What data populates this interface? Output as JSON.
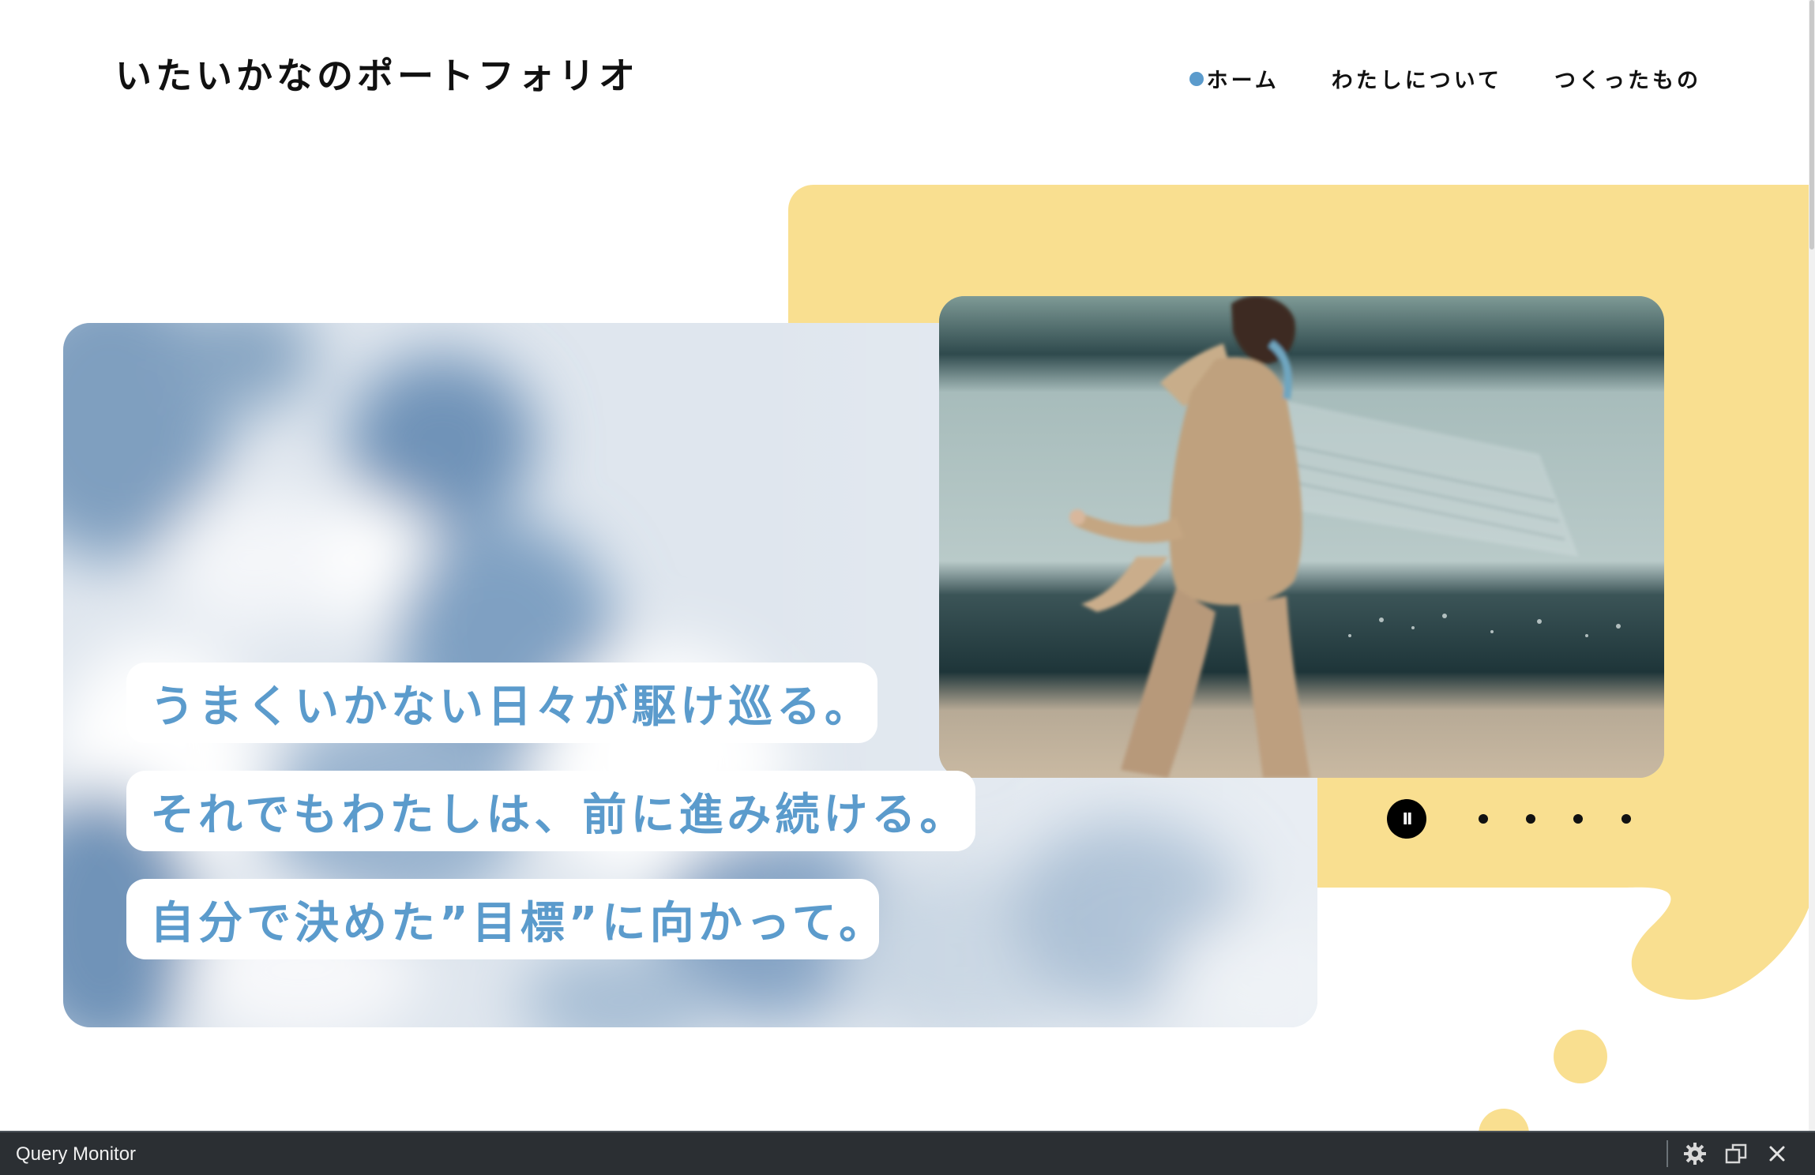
{
  "header": {
    "site_title": "いたいかなのポートフォリオ",
    "nav": [
      {
        "label": "ホーム",
        "active": true
      },
      {
        "label": "わたしについて",
        "active": false
      },
      {
        "label": "つくったもの",
        "active": false
      }
    ]
  },
  "hero": {
    "lines": [
      "うまくいかない日々が駆け巡る。",
      "それでもわたしは、前に進み続ける。",
      "自分で決めた”目標”に向かって。"
    ],
    "slider": {
      "pause_icon": "pause-icon",
      "pause_label": "II",
      "slide_count": 4
    }
  },
  "debug_bar": {
    "label": "Query Monitor",
    "icons": [
      "gear-icon",
      "popout-icon",
      "close-icon"
    ]
  },
  "colors": {
    "accent_blue": "#5b9bcc",
    "yellow": "#f9df90",
    "text_dark": "#111111",
    "debug_bar_bg": "#2b2f33"
  }
}
